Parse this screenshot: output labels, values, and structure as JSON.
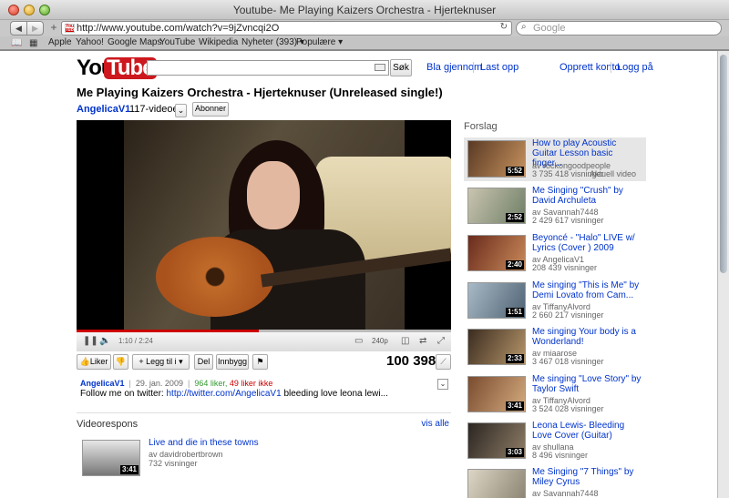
{
  "window": {
    "title": "Youtube- Me Playing Kaizers Orchestra - Hjerteknuser"
  },
  "toolbar": {
    "url": "http://www.youtube.com/watch?v=9jZvncqi2O",
    "search_placeholder": "Google"
  },
  "bookmarks": [
    "Apple",
    "Yahoo!",
    "Google Maps",
    "YouTube",
    "Wikipedia",
    "Nyheter (393) ▾",
    "Populære ▾"
  ],
  "header": {
    "logo_you": "You",
    "logo_tube": "Tube",
    "search_button": "Søk",
    "links": [
      "Bla gjennom",
      "Last opp",
      "Opprett konto",
      "Logg på"
    ]
  },
  "video": {
    "title": "Me Playing Kaizers Orchestra - Hjerteknuser (Unreleased single!)",
    "channel": "AngelicaV1",
    "channel_videos": "117-videoer",
    "subscribe": "Abonner",
    "time": "1:10 / 2:24",
    "progress_fraction": 0.486,
    "quality": "240p",
    "like": "Liker",
    "add_to": "Legg til i",
    "share": "Del",
    "embed": "Innbygg",
    "views": "100 398",
    "uploader": "AngelicaV1",
    "date": "29. jan. 2009",
    "likes": "964 liker,",
    "dislikes": "49 liker ikke",
    "desc_prefix": "Follow me on twitter:",
    "desc_link": "http://twitter.com/AngelicaV1",
    "desc_suffix": "bleeding love leona lewi..."
  },
  "responses": {
    "heading": "Videorespons",
    "see_all": "vis alle",
    "item": {
      "title": "Live and die in these towns",
      "by": "av davidrobertbrown",
      "views": "732 visninger",
      "duration": "3:41"
    }
  },
  "related": {
    "heading": "Forslag",
    "current_label": "Aktuell video",
    "items": [
      {
        "title": "How to play Acoustic Guitar Lesson basic finger...",
        "by": "av rockongoodpeople",
        "views": "3 735 418 visninger",
        "duration": "5:52",
        "current": true
      },
      {
        "title": "Me Singing \"Crush\" by David Archuleta",
        "by": "av Savannah7448",
        "views": "2 429 617 visninger",
        "duration": "2:52"
      },
      {
        "title": "Beyoncé - \"Halo\" LIVE w/ Lyrics (Cover ) 2009",
        "by": "av AngelicaV1",
        "views": "208 439 visninger",
        "duration": "2:40"
      },
      {
        "title": "Me singing \"This is Me\" by Demi Lovato from Cam...",
        "by": "av TiffanyAlvord",
        "views": "2 660 217 visninger",
        "duration": "1:51"
      },
      {
        "title": "Me singing Your body is a Wonderland!",
        "by": "av miaarose",
        "views": "3 467 018 visninger",
        "duration": "2:33"
      },
      {
        "title": "Me singing \"Love Story\" by Taylor Swift",
        "by": "av TiffanyAlvord",
        "views": "3 524 028 visninger",
        "duration": "3:41"
      },
      {
        "title": "Leona Lewis- Bleeding Love Cover (Guitar)",
        "by": "av shullana",
        "views": "8 496 visninger",
        "duration": "3:03"
      },
      {
        "title": "Me Singing \"7 Things\" by Miley Cyrus",
        "by": "av Savannah7448",
        "views": "",
        "duration": ""
      }
    ]
  }
}
